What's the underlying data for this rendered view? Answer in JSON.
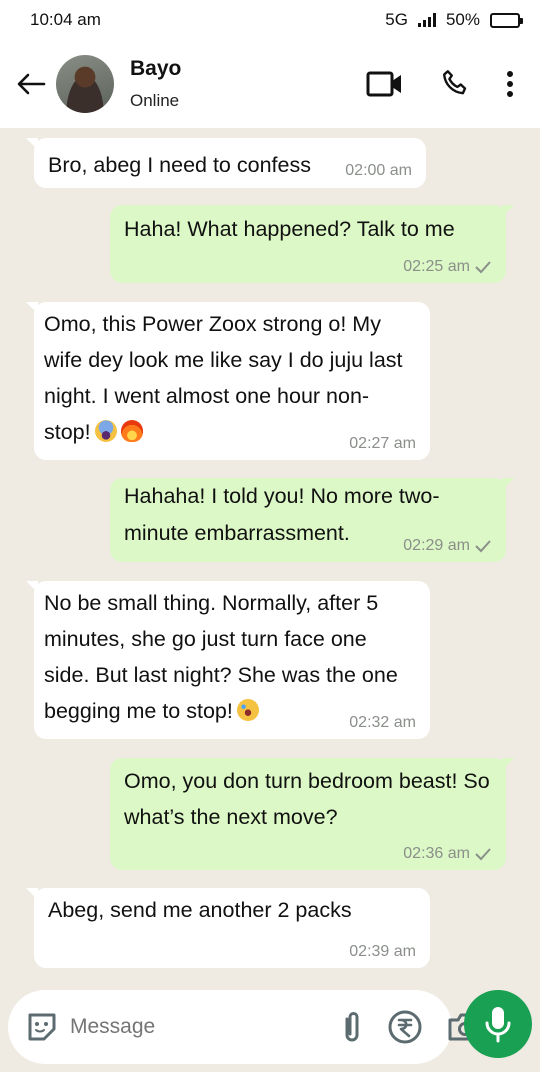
{
  "status_bar": {
    "time": "10:04 am",
    "network": "5G",
    "battery": "50%"
  },
  "header": {
    "name": "Bayo",
    "status": "Online"
  },
  "messages": [
    {
      "dir": "in",
      "text": "Bro, abeg I need to confess",
      "time": "02:00 am"
    },
    {
      "dir": "out",
      "text": "Haha! What happened? Talk to me",
      "time": "02:25 am"
    },
    {
      "dir": "in",
      "text": "Omo, this Power Zoox strong o! My wife dey look me like say I do juju last night. I went almost one hour non-stop!",
      "emoji": [
        "scared-face-emoji",
        "fire-emoji"
      ],
      "time": "02:27 am"
    },
    {
      "dir": "out",
      "text": "Hahaha! I told you! No more two-minute embarrassment.",
      "time": "02:29 am"
    },
    {
      "dir": "in",
      "text": "No be small thing. Normally, after 5 minutes, she go just turn face one side. But last night? She was the one begging me to stop!",
      "emoji": [
        "rolling-laughing-emoji"
      ],
      "time": "02:32 am"
    },
    {
      "dir": "out",
      "text": "Omo, you don turn bedroom beast! So what’s the next move?",
      "time": "02:36 am"
    },
    {
      "dir": "in",
      "text": "Abeg, send me another 2 packs",
      "time": "02:39 am"
    }
  ],
  "composer": {
    "placeholder": "Message"
  },
  "colors": {
    "incoming": "#ffffff",
    "outgoing": "#dcf8c6",
    "accent": "#1aa053",
    "background": "#efeae2"
  }
}
